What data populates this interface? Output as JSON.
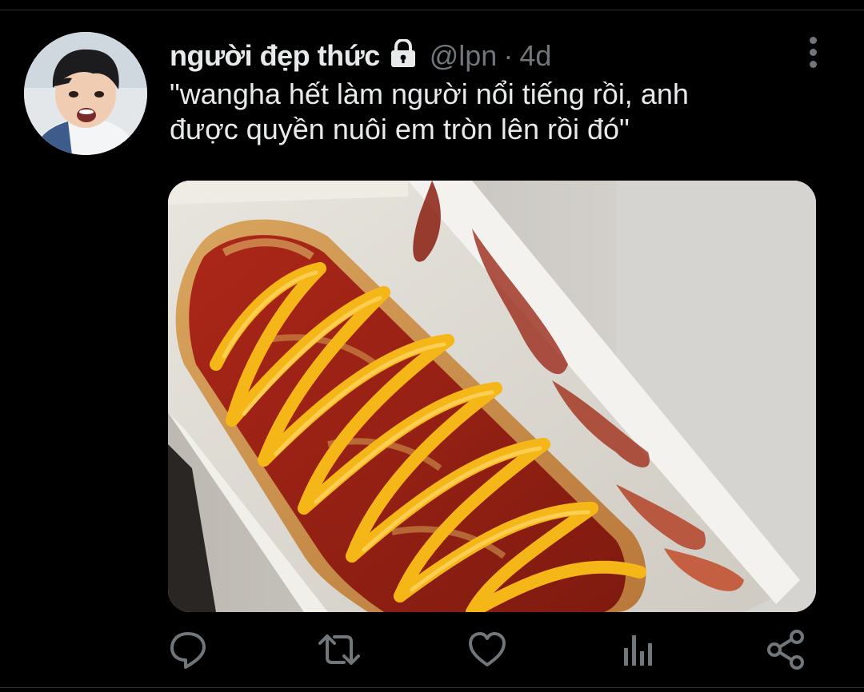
{
  "tweet": {
    "display_name": "người đẹp thức",
    "handle": "@lpn",
    "separator": "·",
    "time": "4d",
    "text_line1": "\"wangha hết làm người nổi tiếng rồi, anh",
    "text_line2": "được quyền nuôi em tròn lên rồi đó\"",
    "protected_icon": "lock-icon",
    "media_description": "photo-of-food"
  },
  "actions": {
    "reply_icon": "reply-icon",
    "retweet_icon": "retweet-icon",
    "like_icon": "heart-icon",
    "analytics_icon": "analytics-icon",
    "share_icon": "share-icon"
  },
  "colors": {
    "background": "#000000",
    "text_primary": "#e7e9ea",
    "text_secondary": "#71767b",
    "divider": "#2f3336"
  }
}
